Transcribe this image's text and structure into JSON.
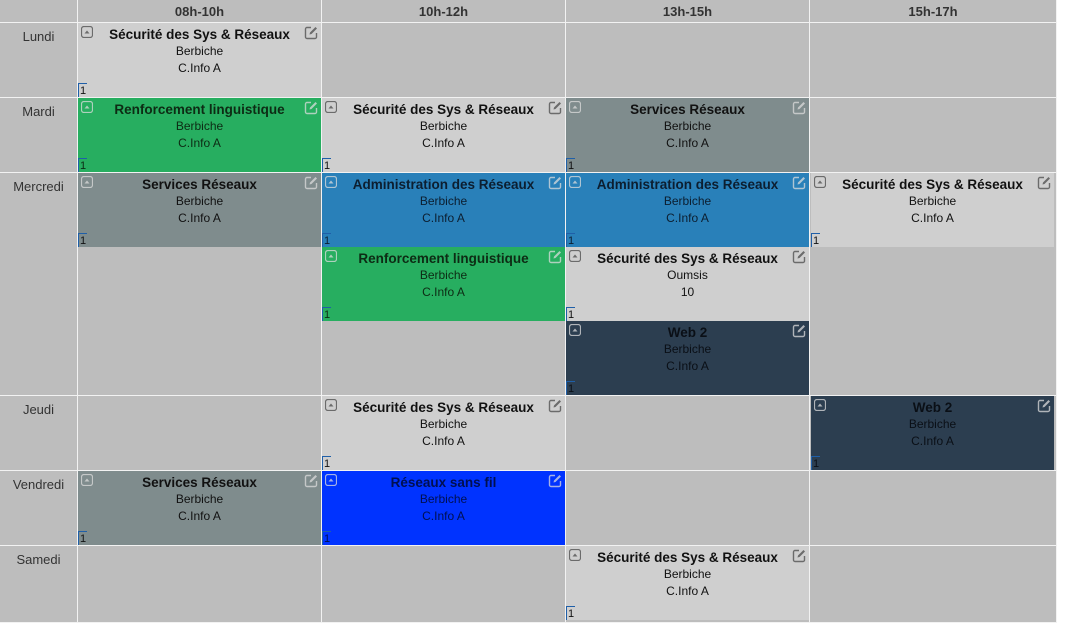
{
  "colors": {
    "light": "#cfcfcf",
    "green": "#27ae60",
    "gray": "#7f8c8d",
    "blue": "#2980b9",
    "navy": "#2c3e50",
    "vivid": "#0033ff",
    "grid": "#bdbdbd"
  },
  "slots": [
    "08h-10h",
    "10h-12h",
    "13h-15h",
    "15h-17h"
  ],
  "days": [
    "Lundi",
    "Mardi",
    "Mercredi",
    "Jeudi",
    "Vendredi",
    "Samedi"
  ],
  "classes": [
    {
      "title": "Sécurité des Sys & Réseaux",
      "teacher": "Berbiche",
      "group": "C.Info A",
      "num": "1",
      "color": "light",
      "day": 0,
      "slot": 0,
      "sub": 0
    },
    {
      "title": "Renforcement linguistique",
      "teacher": "Berbiche",
      "group": "C.Info A",
      "num": "1",
      "color": "green",
      "day": 1,
      "slot": 0,
      "sub": 0
    },
    {
      "title": "Sécurité des Sys & Réseaux",
      "teacher": "Berbiche",
      "group": "C.Info A",
      "num": "1",
      "color": "light",
      "day": 1,
      "slot": 1,
      "sub": 0
    },
    {
      "title": "Services Réseaux",
      "teacher": "Berbiche",
      "group": "C.Info A",
      "num": "1",
      "color": "gray",
      "day": 1,
      "slot": 2,
      "sub": 0
    },
    {
      "title": "Services Réseaux",
      "teacher": "Berbiche",
      "group": "C.Info A",
      "num": "1",
      "color": "gray",
      "day": 2,
      "slot": 0,
      "sub": 0
    },
    {
      "title": "Administration des Réseaux",
      "teacher": "Berbiche",
      "group": "C.Info A",
      "num": "1",
      "color": "blue",
      "day": 2,
      "slot": 1,
      "sub": 0
    },
    {
      "title": "Administration des Réseaux",
      "teacher": "Berbiche",
      "group": "C.Info A",
      "num": "1",
      "color": "blue",
      "day": 2,
      "slot": 2,
      "sub": 0
    },
    {
      "title": "Sécurité des Sys & Réseaux",
      "teacher": "Berbiche",
      "group": "C.Info A",
      "num": "1",
      "color": "light",
      "day": 2,
      "slot": 3,
      "sub": 0
    },
    {
      "title": "Renforcement linguistique",
      "teacher": "Berbiche",
      "group": "C.Info A",
      "num": "1",
      "color": "green",
      "day": 2,
      "slot": 1,
      "sub": 1
    },
    {
      "title": "Sécurité des Sys & Réseaux",
      "teacher": "Oumsis",
      "group": "10",
      "num": "1",
      "color": "light",
      "day": 2,
      "slot": 2,
      "sub": 1
    },
    {
      "title": "Web 2",
      "teacher": "Berbiche",
      "group": "C.Info A",
      "num": "1",
      "color": "navy",
      "day": 2,
      "slot": 2,
      "sub": 2
    },
    {
      "title": "Sécurité des Sys & Réseaux",
      "teacher": "Berbiche",
      "group": "C.Info A",
      "num": "1",
      "color": "light",
      "day": 3,
      "slot": 1,
      "sub": 0
    },
    {
      "title": "Web 2",
      "teacher": "Berbiche",
      "group": "C.Info A",
      "num": "1",
      "color": "navy",
      "day": 3,
      "slot": 3,
      "sub": 0
    },
    {
      "title": "Services Réseaux",
      "teacher": "Berbiche",
      "group": "C.Info A",
      "num": "1",
      "color": "gray",
      "day": 4,
      "slot": 0,
      "sub": 0
    },
    {
      "title": "Réseaux sans fil",
      "teacher": "Berbiche",
      "group": "C.Info A",
      "num": "1",
      "color": "vivid",
      "day": 4,
      "slot": 1,
      "sub": 0
    },
    {
      "title": "Sécurité des Sys & Réseaux",
      "teacher": "Berbiche",
      "group": "C.Info A",
      "num": "1",
      "color": "light",
      "day": 5,
      "slot": 2,
      "sub": 0
    }
  ]
}
